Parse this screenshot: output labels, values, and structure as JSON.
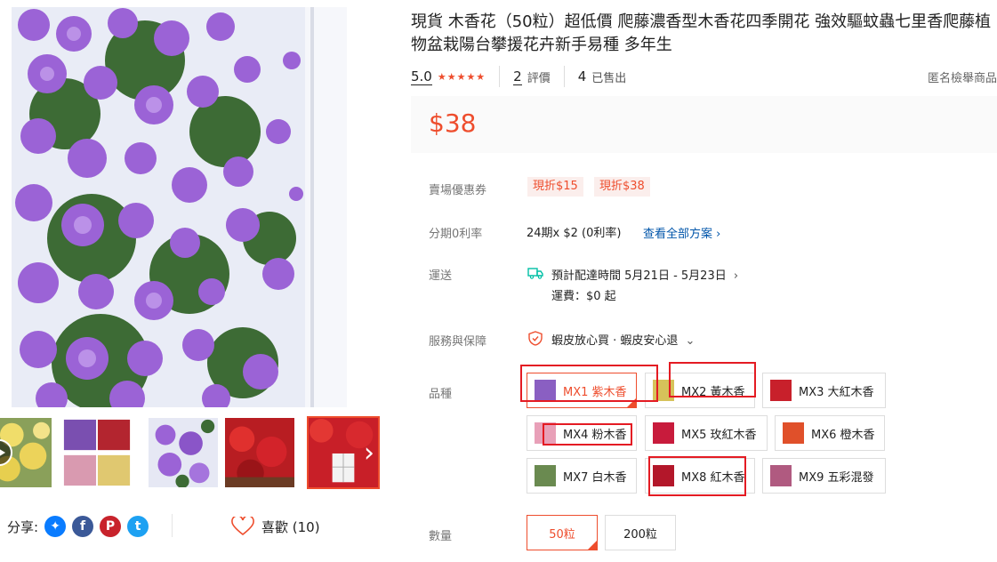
{
  "product": {
    "title": "現貨 木香花（50粒）超低價 爬藤濃香型木香花四季開花 強效驅蚊蟲七里香爬藤植物盆栽陽台攀援花卉新手易種 多年生",
    "rating": "5.0",
    "stars": "★★★★★",
    "reviews_count": "2",
    "reviews_label": "評價",
    "sold_count": "4",
    "sold_label": "已售出",
    "report_label": "匿名檢舉商品",
    "price": "$38"
  },
  "coupons": {
    "label": "賣場優惠券",
    "items": [
      "現折$15",
      "現折$38"
    ]
  },
  "installment": {
    "label": "分期0利率",
    "text": "24期x $2 (0利率)",
    "link": "查看全部方案",
    "chevron": "›"
  },
  "shipping": {
    "label": "運送",
    "icon": "truck-icon",
    "eta": "預計配達時間 5月21日 - 5月23日",
    "chevron": "›",
    "fee": "運費：$0 起"
  },
  "guarantee": {
    "label": "服務與保障",
    "icon": "shield-icon",
    "text": "蝦皮放心買 · 蝦皮安心退",
    "chevron": "⌄"
  },
  "variants": {
    "label": "品種",
    "options": [
      {
        "label": "MX1 紫木香",
        "color": "#8a5fc2",
        "selected": true
      },
      {
        "label": "MX2 黃木香",
        "color": "#d6c25a"
      },
      {
        "label": "MX3 大紅木香",
        "color": "#c8202b"
      },
      {
        "label": "MX4 粉木香",
        "color": "#e8a0b8"
      },
      {
        "label": "MX5 玫紅木香",
        "color": "#c81b3c"
      },
      {
        "label": "MX6 橙木香",
        "color": "#e0502a"
      },
      {
        "label": "MX7 白木香",
        "color": "#6a8a50"
      },
      {
        "label": "MX8 紅木香",
        "color": "#b3172a"
      },
      {
        "label": "MX9 五彩混發",
        "color": "#b05a80"
      }
    ]
  },
  "quantity": {
    "label": "數量",
    "options": [
      "50粒",
      "200粒"
    ]
  },
  "share": {
    "label": "分享:",
    "icons": [
      "messenger-icon",
      "facebook-icon",
      "pinterest-icon",
      "twitter-icon"
    ]
  },
  "like": {
    "label": "喜歡 (10)"
  },
  "colors": {
    "accent": "#ee4d2d",
    "link": "#0055aa",
    "annotation": "#e41b23"
  }
}
